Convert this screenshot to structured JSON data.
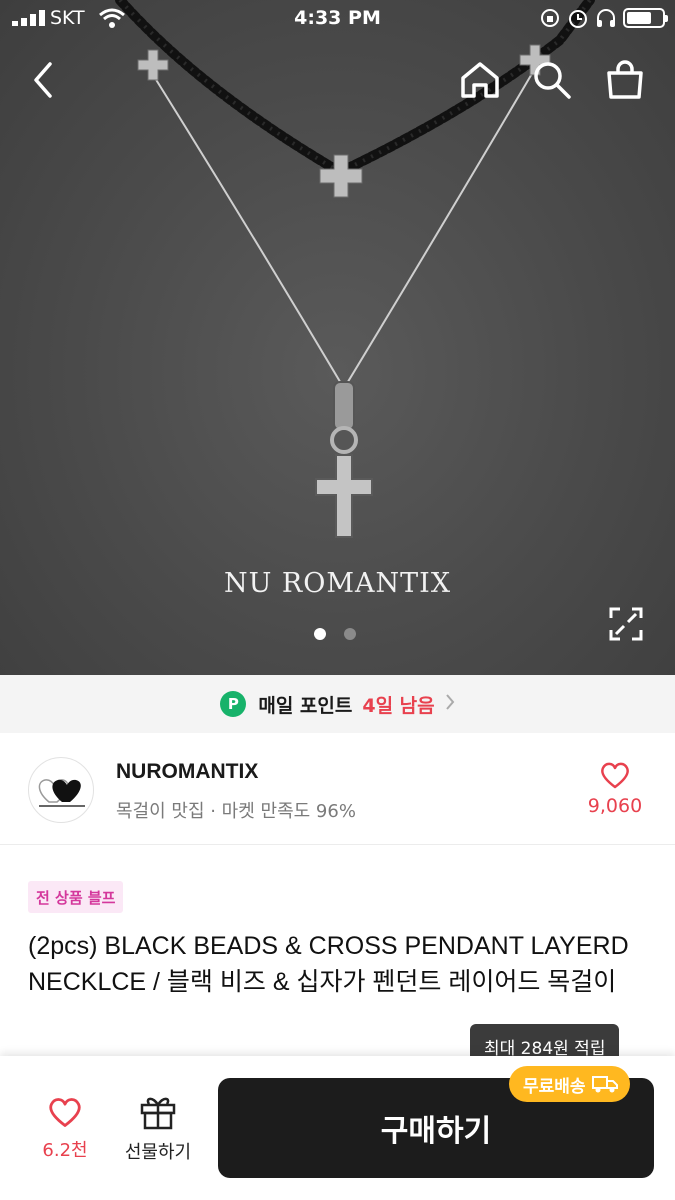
{
  "status_bar": {
    "carrier": "SKT",
    "time": "4:33 PM"
  },
  "hero": {
    "watermark": "NU ROMANTIX",
    "slide_count": 2,
    "active_slide": 1
  },
  "nav": {
    "back_icon": "chevron-left-icon",
    "home_icon": "home-icon",
    "search_icon": "search-icon",
    "cart_icon": "shopping-bag-icon"
  },
  "points_bar": {
    "badge": "P",
    "label": "매일 포인트",
    "remaining": "4일 남음",
    "chevron": "›"
  },
  "shop": {
    "name": "NUROMANTIX",
    "meta": "목걸이 맛집 · 마켓 만족도 96%",
    "like_count": "9,060"
  },
  "product": {
    "tag": "전 상품 블프",
    "title": "(2pcs) BLACK BEADS & CROSS PENDANT LAYERD NECKLCE / 블랙 비즈 & 십자가 펜던트 레이어드 목걸이",
    "points_tooltip": "최대 284원 적립"
  },
  "bottom_bar": {
    "like_count": "6.2천",
    "gift_label": "선물하기",
    "buy_label": "구매하기",
    "free_shipping_badge": "무료배송"
  },
  "colors": {
    "accent_red": "#e8414e",
    "points_green": "#17b26a",
    "tag_pink": "#d4389c",
    "shipping_orange": "#ffb820",
    "buy_button": "#1c1c1c"
  }
}
